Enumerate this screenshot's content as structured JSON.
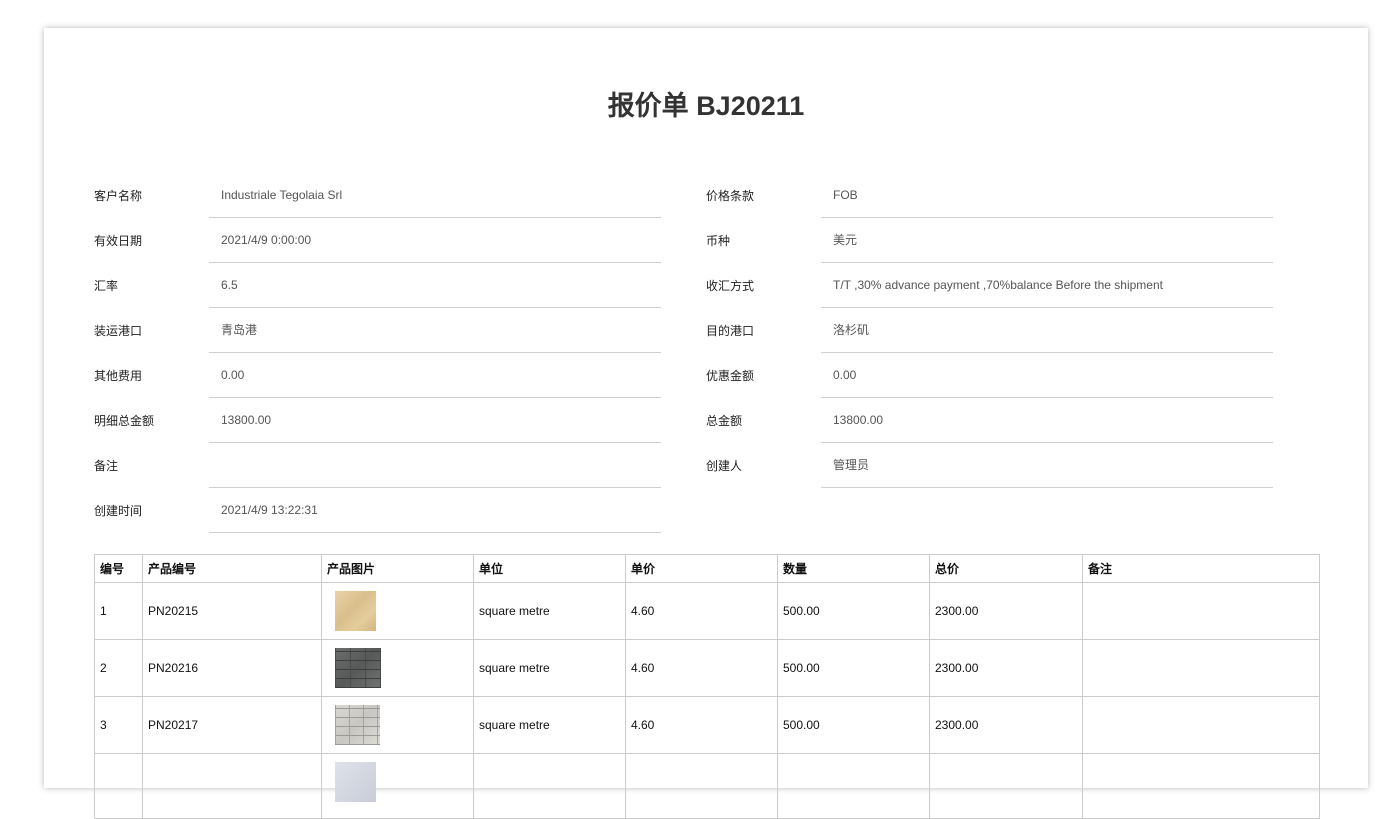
{
  "title": "报价单 BJ20211",
  "left_fields": [
    {
      "label": "客户名称",
      "value": "Industriale Tegolaia Srl"
    },
    {
      "label": "有效日期",
      "value": "2021/4/9 0:00:00"
    },
    {
      "label": "汇率",
      "value": "6.5"
    },
    {
      "label": "装运港口",
      "value": "青岛港"
    },
    {
      "label": "其他费用",
      "value": "0.00"
    },
    {
      "label": "明细总金额",
      "value": "13800.00"
    },
    {
      "label": "备注",
      "value": ""
    },
    {
      "label": "创建时间",
      "value": "2021/4/9 13:22:31"
    }
  ],
  "right_fields": [
    {
      "label": "价格条款",
      "value": "FOB"
    },
    {
      "label": "币种",
      "value": "美元"
    },
    {
      "label": "收汇方式",
      "value": "T/T ,30% advance payment ,70%balance Before the shipment"
    },
    {
      "label": "目的港口",
      "value": "洛杉矶"
    },
    {
      "label": "优惠金额",
      "value": "0.00"
    },
    {
      "label": "总金额",
      "value": "13800.00"
    },
    {
      "label": "创建人",
      "value": "管理员"
    }
  ],
  "table": {
    "headers": [
      "编号",
      "产品编号",
      "产品图片",
      "单位",
      "单价",
      "数量",
      "总价",
      "备注"
    ],
    "rows": [
      {
        "no": "1",
        "code": "PN20215",
        "image": "beige-sandstone-tile",
        "unit": "square metre",
        "price": "4.60",
        "qty": "500.00",
        "total": "2300.00",
        "note": ""
      },
      {
        "no": "2",
        "code": "PN20216",
        "image": "dark-grey-brick-tile",
        "unit": "square metre",
        "price": "4.60",
        "qty": "500.00",
        "total": "2300.00",
        "note": ""
      },
      {
        "no": "3",
        "code": "PN20217",
        "image": "light-grey-brick-tile",
        "unit": "square metre",
        "price": "4.60",
        "qty": "500.00",
        "total": "2300.00",
        "note": ""
      },
      {
        "no": "",
        "code": "",
        "image": "light-marble-tile",
        "unit": "",
        "price": "",
        "qty": "",
        "total": "",
        "note": ""
      }
    ]
  }
}
